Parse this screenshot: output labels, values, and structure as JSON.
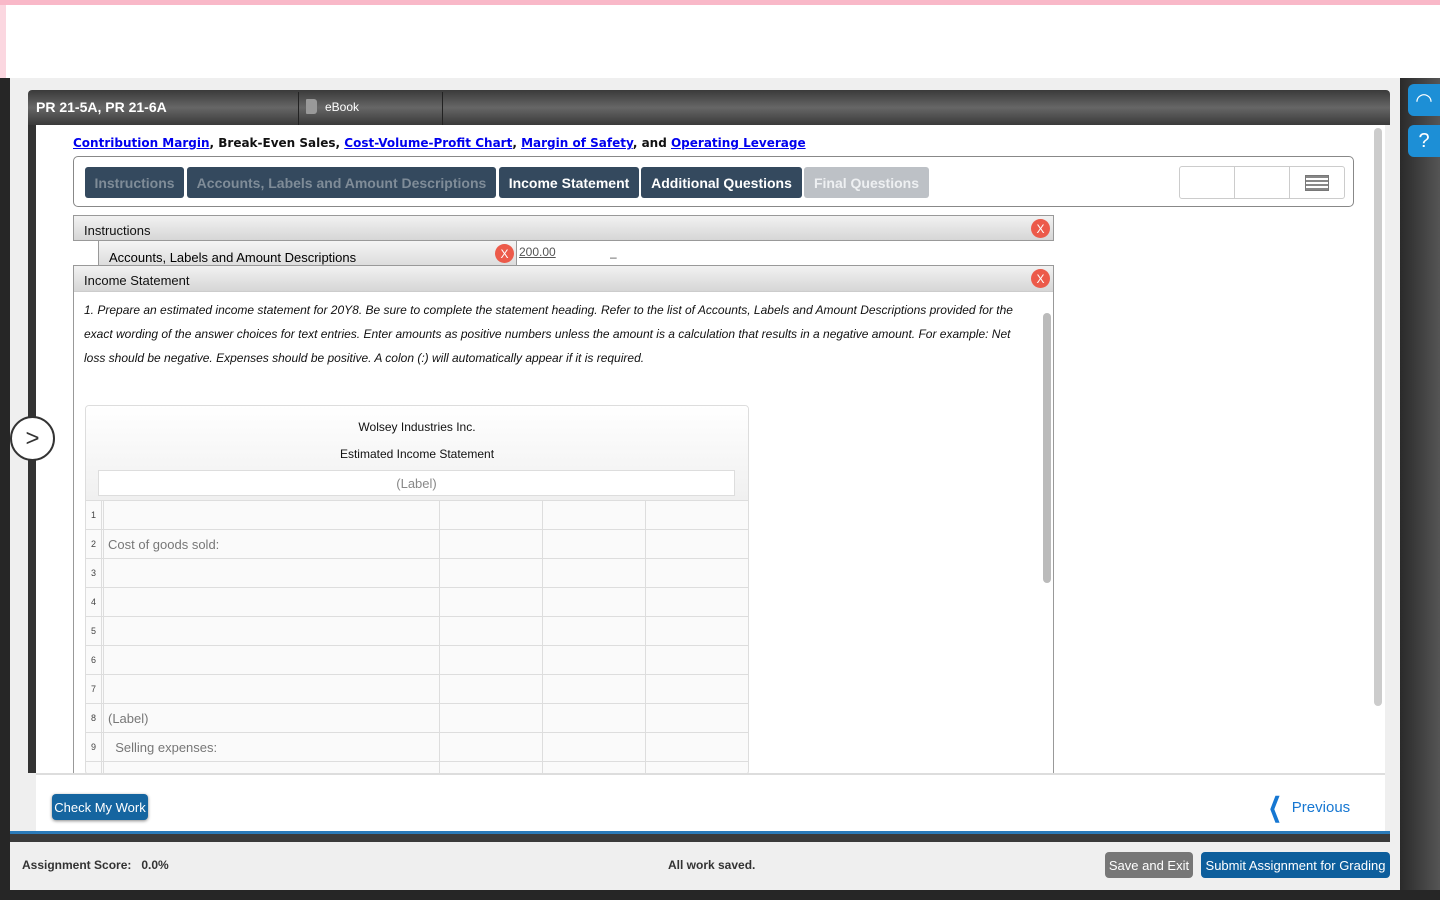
{
  "header": {
    "title": "PR 21-5A, PR 21-6A",
    "ebook": "eBook"
  },
  "topic": {
    "link1": "Contribution Margin",
    "sep1": ", Break-Even Sales, ",
    "link2": "Cost-Volume-Profit Chart",
    "sep2": ", ",
    "link3": "Margin of Safety",
    "sep3": ", and ",
    "link4": "Operating Leverage"
  },
  "tabs": [
    {
      "label": "Instructions",
      "state": "visited"
    },
    {
      "label": "Accounts, Labels and Amount Descriptions",
      "state": "visited"
    },
    {
      "label": "Income Statement",
      "state": "active"
    },
    {
      "label": "Additional Questions",
      "state": "active"
    },
    {
      "label": "Final Questions",
      "state": "disabled"
    }
  ],
  "panels": {
    "instructions": "Instructions",
    "accounts": "Accounts, Labels and Amount Descriptions",
    "accounts_value": "200.00",
    "accounts_dash": "–",
    "income": "Income Statement",
    "close": "X"
  },
  "instructions_text": "1. Prepare an estimated income statement for 20Y8. Be sure to complete the statement heading. Refer to the list of Accounts, Labels and Amount Descriptions provided for the exact wording of the answer choices for text entries. Enter amounts as positive numbers unless the amount is a calculation that results in a negative amount. For example: Net loss should be negative. Expenses should be positive. A colon (:) will automatically appear if it is required.",
  "statement": {
    "company": "Wolsey Industries Inc.",
    "name": "Estimated Income Statement",
    "date_placeholder": "(Label)",
    "rows": [
      {
        "n": "1",
        "label": ""
      },
      {
        "n": "2",
        "label": "Cost of goods sold:"
      },
      {
        "n": "3",
        "label": ""
      },
      {
        "n": "4",
        "label": ""
      },
      {
        "n": "5",
        "label": ""
      },
      {
        "n": "6",
        "label": ""
      },
      {
        "n": "7",
        "label": ""
      },
      {
        "n": "8",
        "label": "(Label)"
      },
      {
        "n": "9",
        "label": "  Selling expenses:"
      },
      {
        "n": "",
        "label": ""
      }
    ]
  },
  "footer": {
    "check": "Check My Work",
    "previous": "Previous",
    "score_label": "Assignment Score:",
    "score": "0.0%",
    "saved": "All work saved.",
    "save_exit": "Save and Exit",
    "submit": "Submit Assignment for Grading"
  },
  "icons": {
    "support": "headset-icon",
    "help": "question-icon",
    "expand": "chevron-right-icon"
  }
}
